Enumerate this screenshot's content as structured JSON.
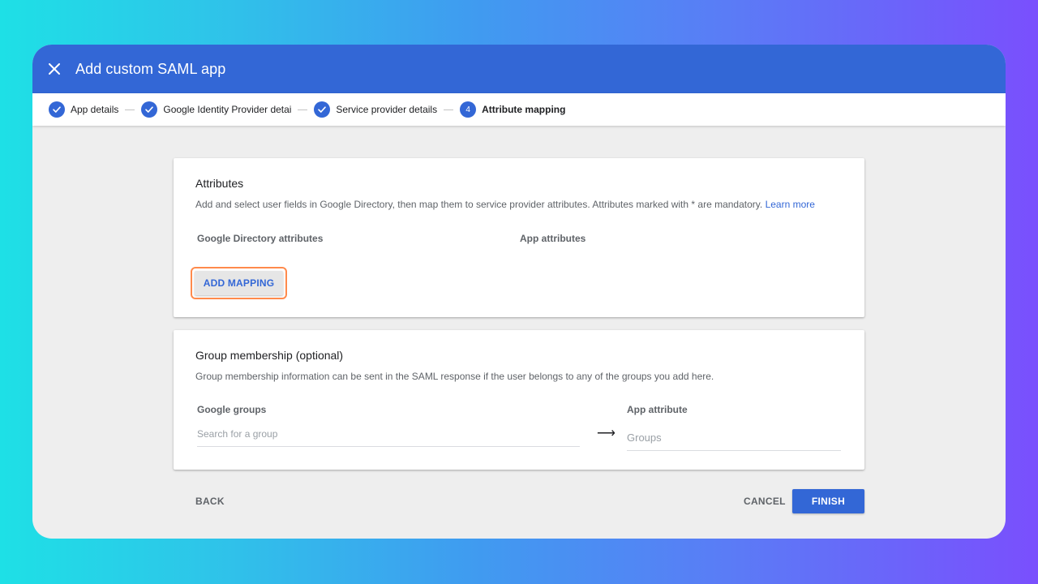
{
  "dialog": {
    "title": "Add custom SAML app"
  },
  "stepper": {
    "steps": [
      {
        "label": "App details",
        "state": "done"
      },
      {
        "label": "Google Identity Provider details",
        "state": "done"
      },
      {
        "label": "Service provider details",
        "state": "done"
      },
      {
        "label": "Attribute mapping",
        "state": "active",
        "number": "4"
      }
    ]
  },
  "attributes": {
    "title": "Attributes",
    "description": "Add and select user fields in Google Directory, then map them to service provider attributes. Attributes marked with * are mandatory.",
    "learn_more": "Learn more",
    "col_directory": "Google Directory attributes",
    "col_app": "App attributes",
    "add_mapping_label": "ADD MAPPING"
  },
  "group_membership": {
    "title": "Group membership (optional)",
    "description": "Group membership information can be sent in the SAML response if the user belongs to any of the groups you add here.",
    "col_groups": "Google groups",
    "col_app_attribute": "App attribute",
    "search_placeholder": "Search for a group",
    "app_attribute_placeholder": "Groups"
  },
  "footer": {
    "back_label": "BACK",
    "cancel_label": "CANCEL",
    "finish_label": "FINISH"
  },
  "colors": {
    "primary": "#3367d6",
    "highlight": "#ff8a4c"
  }
}
